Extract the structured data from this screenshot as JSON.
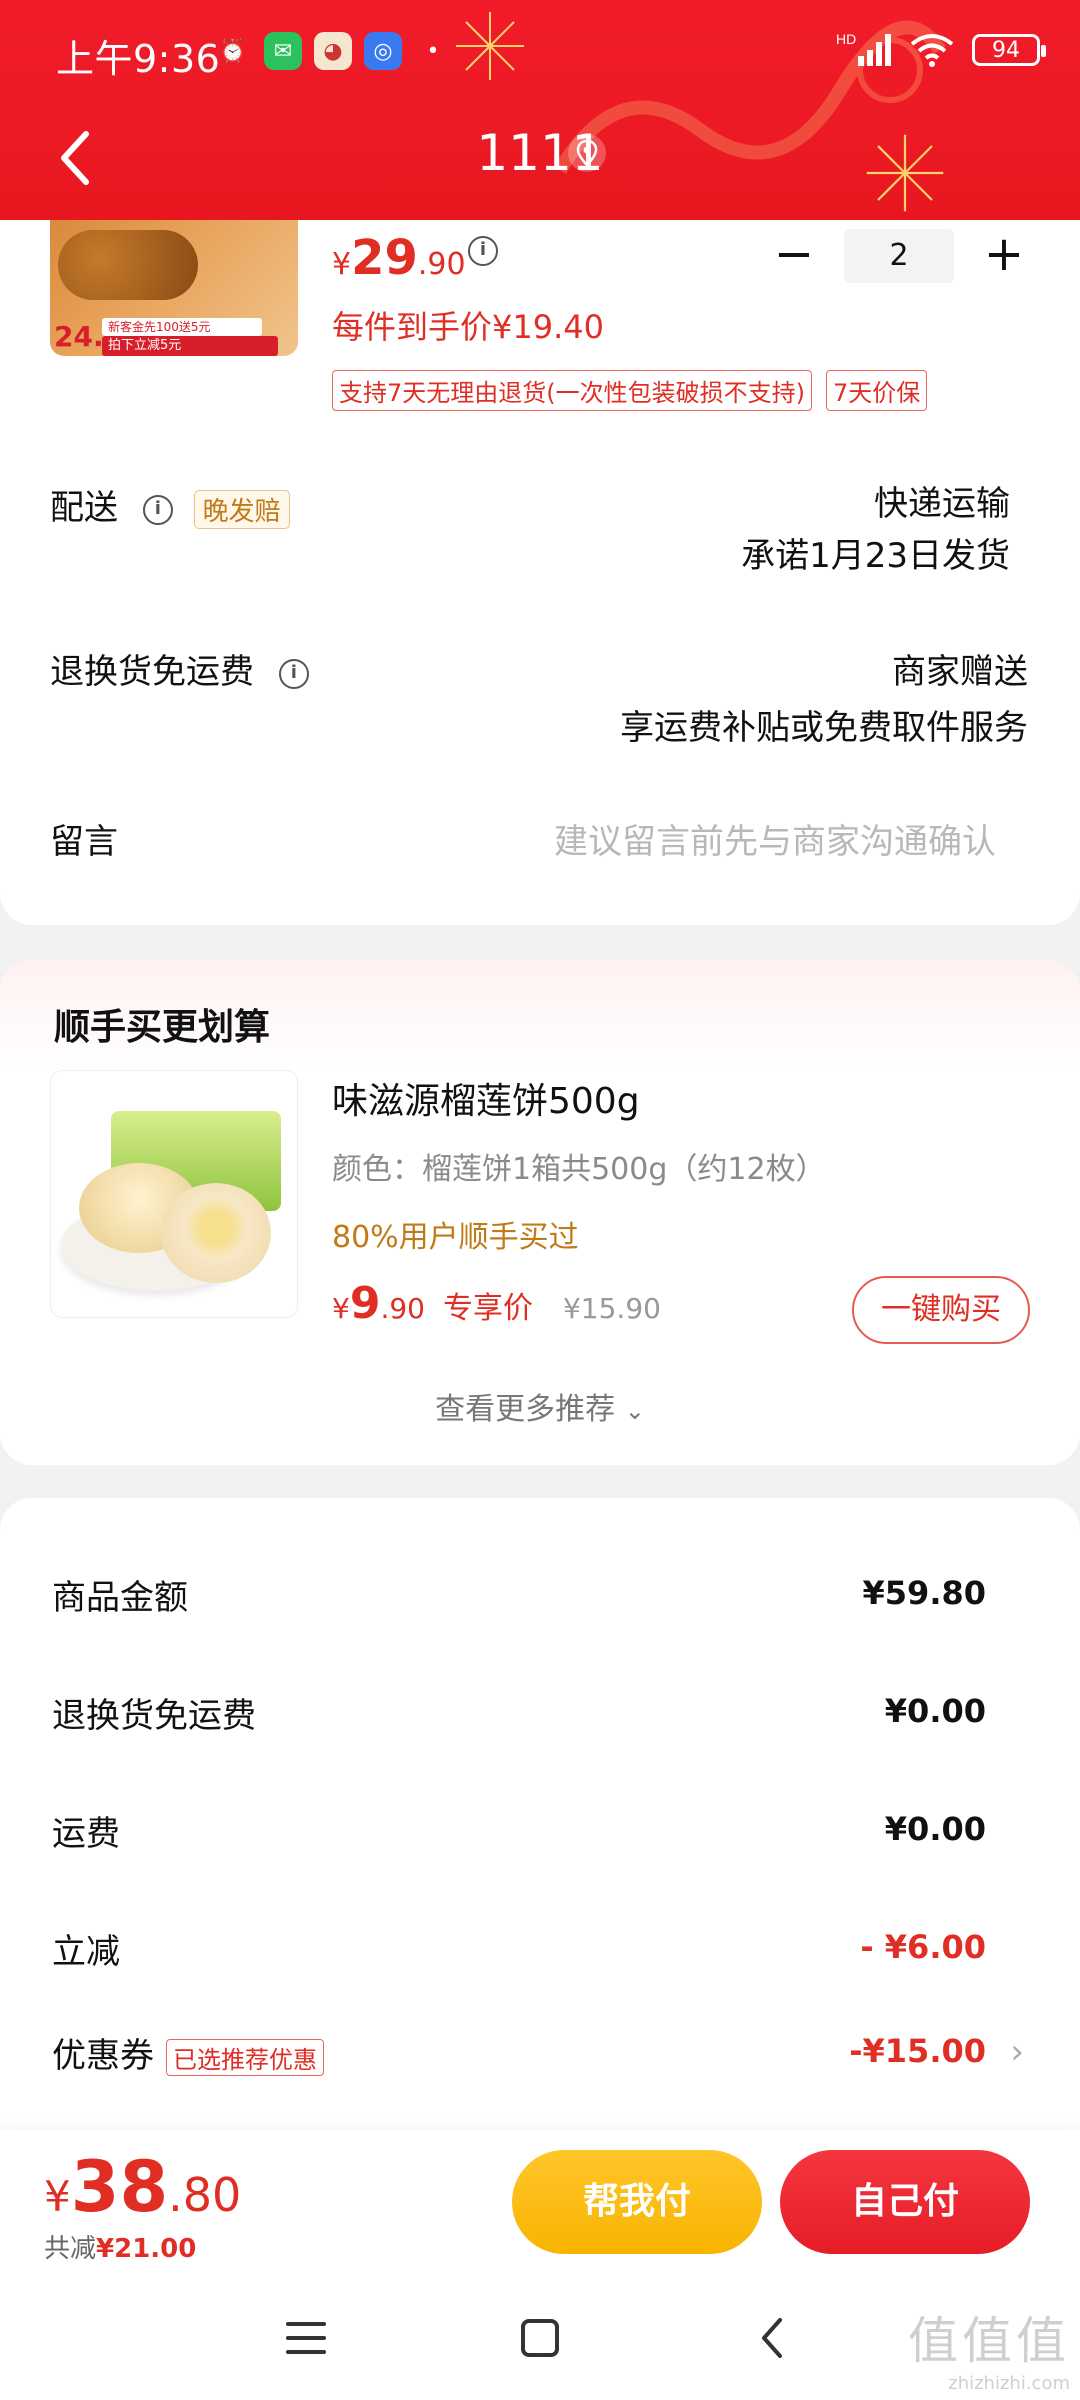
{
  "status": {
    "time": "上午9:36",
    "battery": "94",
    "network": "HD"
  },
  "header": {
    "title": "1111"
  },
  "product": {
    "price_int": "29",
    "price_dec": ".90",
    "currency": "¥",
    "quantity": "2",
    "per_item_price": "每件到手价¥19.40",
    "tags": [
      "支持7天无理由退货(一次性包装破损不支持)",
      "7天价保"
    ],
    "img_price": "24.9",
    "img_badge1": "新客金先100送5元",
    "img_badge2": "拍下立减5元"
  },
  "delivery": {
    "label": "配送",
    "chip": "晚发赔",
    "method": "快递运输",
    "promise": "承诺1月23日发货"
  },
  "return_shipping": {
    "label": "退换货免运费",
    "value": "商家赠送",
    "desc": "享运费补贴或免费取件服务"
  },
  "message": {
    "label": "留言",
    "placeholder": "建议留言前先与商家沟通确认"
  },
  "recommend": {
    "title": "顺手买更划算",
    "name": "味滋源榴莲饼500g",
    "spec": "颜色：榴莲饼1箱共500g（约12枚）",
    "social": "80%用户顺手买过",
    "currency": "¥",
    "price_int": "9",
    "price_dec": ".90",
    "price_label": "专享价",
    "orig_price": "¥15.90",
    "buy_label": "一键购买",
    "more_label": "查看更多推荐"
  },
  "summary": {
    "rows": [
      {
        "label": "商品金额",
        "value": "¥59.80"
      },
      {
        "label": "退换货免运费",
        "value": "¥0.00"
      },
      {
        "label": "运费",
        "value": "¥0.00"
      },
      {
        "label": "立减",
        "value": "- ¥6.00"
      },
      {
        "label": "优惠券",
        "chip": "已选推荐优惠",
        "value": "-¥15.00"
      }
    ]
  },
  "bottom": {
    "currency": "¥",
    "total_int": "38",
    "total_dec": ".80",
    "saved_label": "共减",
    "saved_amount": "¥21.00",
    "help_pay": "帮我付",
    "self_pay": "自己付"
  },
  "watermark": {
    "big": "值值值",
    "small": "zhizhizhi.com"
  },
  "colors": {
    "brand_red": "#e02e24",
    "header_red": "#ec1a24",
    "help_yellow": "#f8b400"
  }
}
